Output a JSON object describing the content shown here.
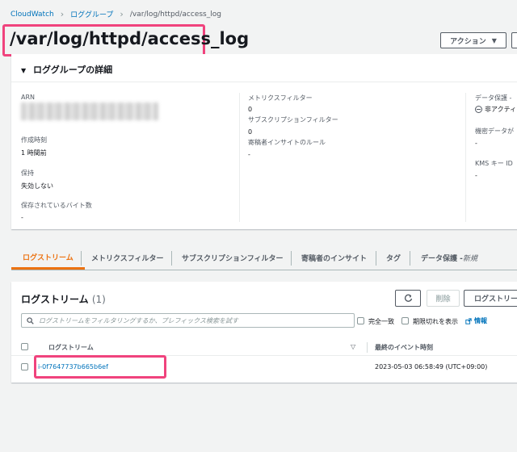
{
  "breadcrumb": {
    "items": [
      "CloudWatch",
      "ロググループ",
      "/var/log/httpd/access_log"
    ]
  },
  "page": {
    "title": "/var/log/httpd/access_log",
    "action_button": "アクション"
  },
  "details": {
    "header": "ロググループの詳細",
    "col1": {
      "arn_label": "ARN",
      "created_label": "作成時刻",
      "created_value": "1 時間前",
      "retention_label": "保持",
      "retention_value": "失効しない",
      "stored_bytes_label": "保存されているバイト数",
      "stored_bytes_value": "-"
    },
    "col2": {
      "metric_filters_label": "メトリクスフィルター",
      "metric_filters_value": "0",
      "subscription_filters_label": "サブスクリプションフィルター",
      "subscription_filters_value": "0",
      "contributor_label": "寄稿者インサイトのルール",
      "contributor_value": "-"
    },
    "col3": {
      "data_protection_label": "データ保護 -",
      "data_protection_value": "非アクティ",
      "sensitive_label": "機密データが",
      "sensitive_value": "-",
      "kms_label": "KMS キー ID",
      "kms_value": "-"
    }
  },
  "tabs": [
    {
      "label": "ログストリーム"
    },
    {
      "label": "メトリクスフィルター"
    },
    {
      "label": "サブスクリプションフィルター"
    },
    {
      "label": "寄稿者のインサイト"
    },
    {
      "label": "タグ"
    },
    {
      "label": "データ保護 - ",
      "suffix": "新規"
    }
  ],
  "streams": {
    "title": "ログストリーム",
    "count": "(1)",
    "delete_button": "削除",
    "create_button": "ログストリー",
    "search_placeholder": "ログストリームをフィルタリングするか、プレフィックス検索を試す",
    "exact_match_label": "完全一致",
    "show_expired_label": "期限切れを表示",
    "info_link": "情報",
    "columns": [
      "ログストリーム",
      "最終のイベント時刻"
    ],
    "rows": [
      {
        "name": "i-0f7647737b665b6ef",
        "last_event": "2023-05-03 06:58:49 (UTC+09:00)"
      }
    ]
  }
}
